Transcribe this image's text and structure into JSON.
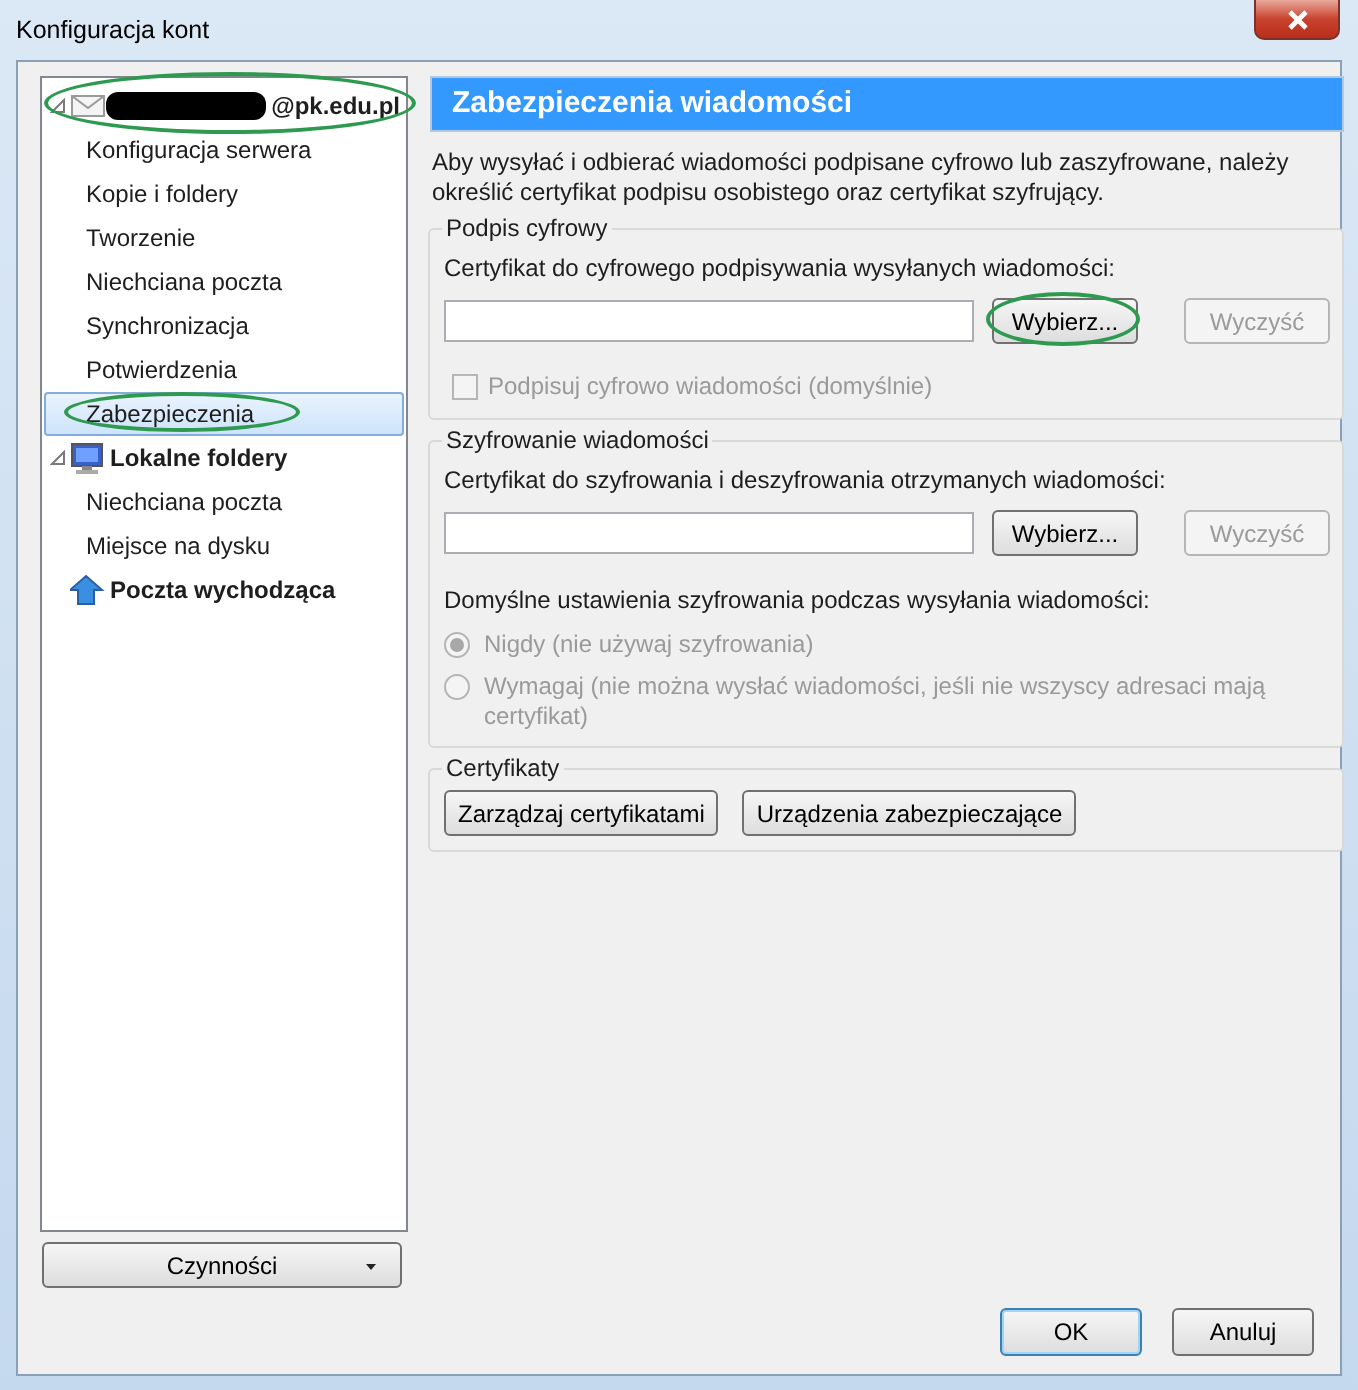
{
  "window": {
    "title": "Konfiguracja kont"
  },
  "tree": [
    {
      "label": "@pk.edu.pl",
      "kind": "account",
      "expanded": true,
      "redacted": true,
      "selected": false,
      "circled": true,
      "children": [
        {
          "label": "Konfiguracja serwera",
          "selected": false,
          "circled": false
        },
        {
          "label": "Kopie i foldery",
          "selected": false,
          "circled": false
        },
        {
          "label": "Tworzenie",
          "selected": false,
          "circled": false
        },
        {
          "label": "Niechciana poczta",
          "selected": false,
          "circled": false
        },
        {
          "label": "Synchronizacja",
          "selected": false,
          "circled": false
        },
        {
          "label": "Potwierdzenia",
          "selected": false,
          "circled": false
        },
        {
          "label": "Zabezpieczenia",
          "selected": true,
          "circled": true
        }
      ]
    },
    {
      "label": "Lokalne foldery",
      "kind": "local",
      "expanded": true,
      "redacted": false,
      "selected": false,
      "circled": false,
      "children": [
        {
          "label": "Niechciana poczta",
          "selected": false,
          "circled": false
        },
        {
          "label": "Miejsce na dysku",
          "selected": false,
          "circled": false
        }
      ]
    },
    {
      "label": "Poczta wychodząca",
      "kind": "outgoing",
      "selected": false,
      "circled": false
    }
  ],
  "actions_button": {
    "label": "Czynności"
  },
  "panel": {
    "title": "Zabezpieczenia wiadomości",
    "intro": "Aby wysyłać i odbierać wiadomości podpisane cyfrowo lub zaszyfrowane, należy określić certyfikat podpisu osobistego oraz certyfikat szyfrujący.",
    "signing": {
      "legend": "Podpis cyfrowy",
      "label": "Certyfikat do cyfrowego podpisywania wysyłanych wiadomości:",
      "select_button": {
        "label": "Wybierz...",
        "circled": true
      },
      "clear_button": {
        "label": "Wyczyść",
        "disabled": true
      },
      "checkbox": {
        "label": "Podpisuj cyfrowo wiadomości (domyślnie)",
        "checked": false,
        "disabled": true
      }
    },
    "encryption": {
      "legend": "Szyfrowanie wiadomości",
      "label": "Certyfikat do szyfrowania i deszyfrowania otrzymanych wiadomości:",
      "select_button": {
        "label": "Wybierz...",
        "circled": false
      },
      "clear_button": {
        "label": "Wyczyść",
        "disabled": true
      },
      "default_label": "Domyślne ustawienia szyfrowania podczas wysyłania wiadomości:",
      "options": [
        {
          "label": "Nigdy (nie używaj szyfrowania)",
          "selected": true,
          "disabled": true
        },
        {
          "label": "Wymagaj (nie można wysłać wiadomości, jeśli nie wszyscy adresaci mają certyfikat)",
          "selected": false,
          "disabled": true
        }
      ]
    },
    "certificates": {
      "legend": "Certyfikaty",
      "buttons": [
        {
          "label": "Zarządzaj certyfikatami"
        },
        {
          "label": "Urządzenia zabezpieczające"
        }
      ]
    }
  },
  "footer_buttons": [
    {
      "label": "OK",
      "default": true
    },
    {
      "label": "Anuluj",
      "default": false
    }
  ]
}
